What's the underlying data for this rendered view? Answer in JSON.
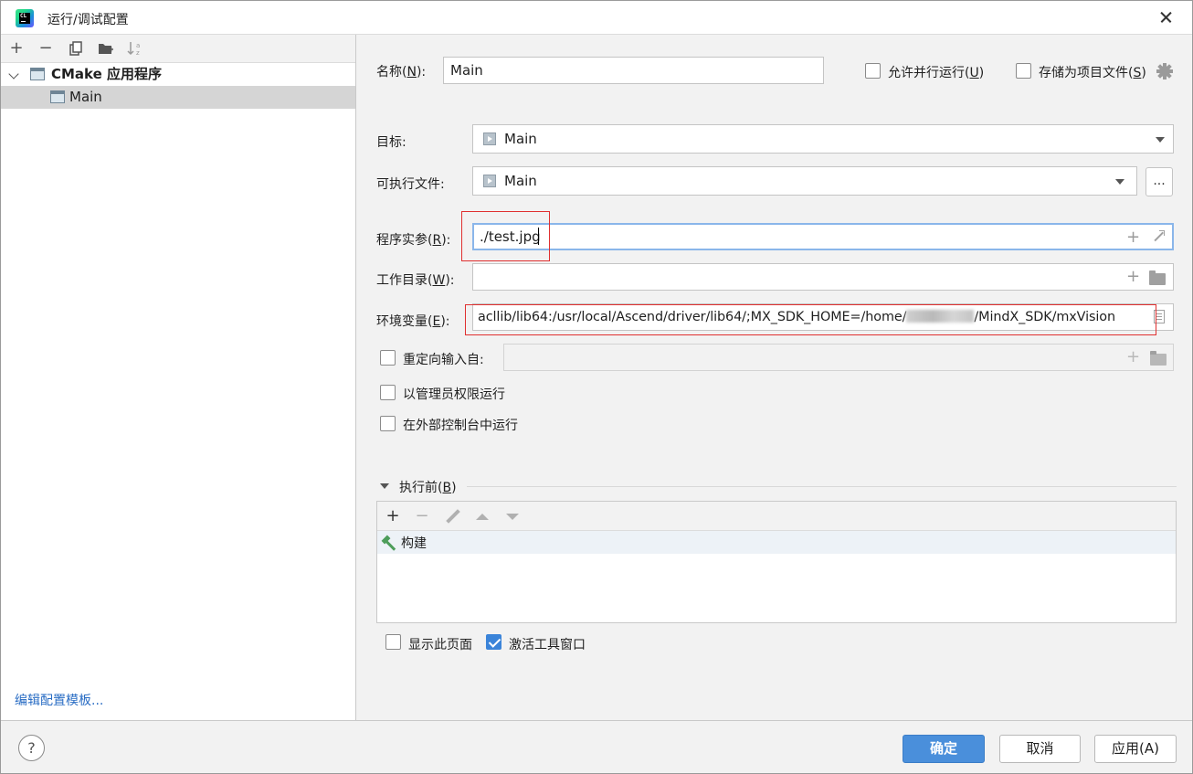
{
  "window": {
    "title": "运行/调试配置",
    "app_icon": "clion-icon",
    "app_icon_text": "CL"
  },
  "left": {
    "toolbar": {
      "add": "+",
      "remove": "−",
      "copy": "copy-icon",
      "folder": "new-folder-icon",
      "sort": "sort-icon"
    },
    "tree": {
      "group_label": "CMake 应用程序",
      "item_label": "Main"
    },
    "edit_templates_link": "编辑配置模板..."
  },
  "form": {
    "name_label": "名称(",
    "name_mnemonic": "N",
    "name_value": "Main",
    "allow_parallel_label": "允许并行运行(",
    "allow_parallel_mnemonic": "U",
    "allow_parallel_checked": false,
    "store_as_file_label": "存储为项目文件(",
    "store_as_file_mnemonic": "S",
    "store_as_file_checked": false,
    "target_label": "目标:",
    "target_value": "Main",
    "executable_label": "可执行文件:",
    "executable_value": "Main",
    "browse_button": "...",
    "program_args_label": "程序实参(",
    "program_args_mnemonic": "R",
    "program_args_value": "./test.jpg",
    "working_dir_label": "工作目录(",
    "working_dir_mnemonic": "W",
    "working_dir_value": "",
    "env_label": "环境变量(",
    "env_mnemonic": "E",
    "env_value_part1": "acllib/lib64:/usr/local/Ascend/driver/lib64/;MX_SDK_HOME=/home/",
    "env_value_part2": "/MindX_SDK/mxVision",
    "redirect_label": "重定向输入自:",
    "redirect_checked": false,
    "run_as_admin_label": "以管理员权限运行",
    "run_as_admin_checked": false,
    "run_in_console_label": "在外部控制台中运行",
    "run_in_console_checked": false,
    "colon_suffix": "):"
  },
  "before_launch": {
    "label": "执行前(",
    "mnemonic": "B",
    "tasks": [
      "构建"
    ],
    "show_page_label": "显示此页面",
    "show_page_checked": false,
    "activate_tool_window_label": "激活工具窗口",
    "activate_tool_window_checked": true
  },
  "footer": {
    "help": "?",
    "ok": "确定",
    "cancel": "取消",
    "apply": "应用(A)"
  },
  "colors": {
    "accent": "#4a8fdb",
    "link": "#2a6dc4",
    "highlight_box": "#e03030",
    "build_icon": "#4d9d5a"
  }
}
